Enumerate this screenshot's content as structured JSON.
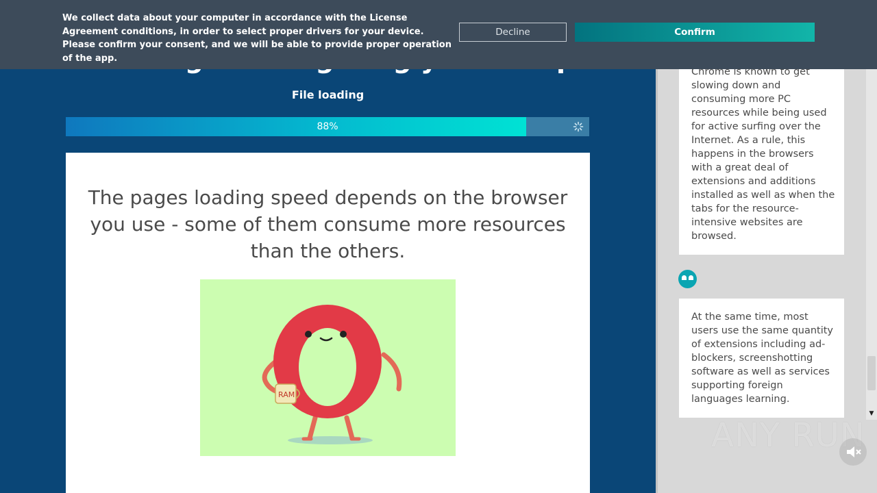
{
  "consent": {
    "message": "We collect data about your computer in accordance with the License Agreement conditions, in order to select proper drivers for your device. Please confirm your consent, and we will be able to provide proper operation of the app.",
    "decline_label": "Decline",
    "confirm_label": "Confirm"
  },
  "main": {
    "header_title": "Installing & configuring your computer",
    "file_loading": "File loading",
    "progress_percent": 88,
    "progress_label": "88%",
    "card_text": "The pages loading speed depends on the browser you use - some of them consume more resources than the others.",
    "mug_label": "RAM"
  },
  "chat": {
    "message1": "Chrome is known to get slowing down and consuming more PC resources while being used for active surfing over the Internet. As a rule, this happens in the browsers with a great deal of extensions and additions installed as well as when the tabs for the resource-intensive websites are browsed.",
    "message2": "At the same time, most users use the same quantity of extensions including ad-blockers, screenshotting software as well as services supporting foreign languages learning."
  },
  "watermark": "ANY RUN",
  "colors": {
    "page_background": "#0a4677",
    "consent_bar": "#3d4b5a",
    "confirm_start": "#03737f",
    "confirm_end": "#12b5a9",
    "illustration_background": "#ccfdb1",
    "mascot_red": "#e23a47"
  }
}
